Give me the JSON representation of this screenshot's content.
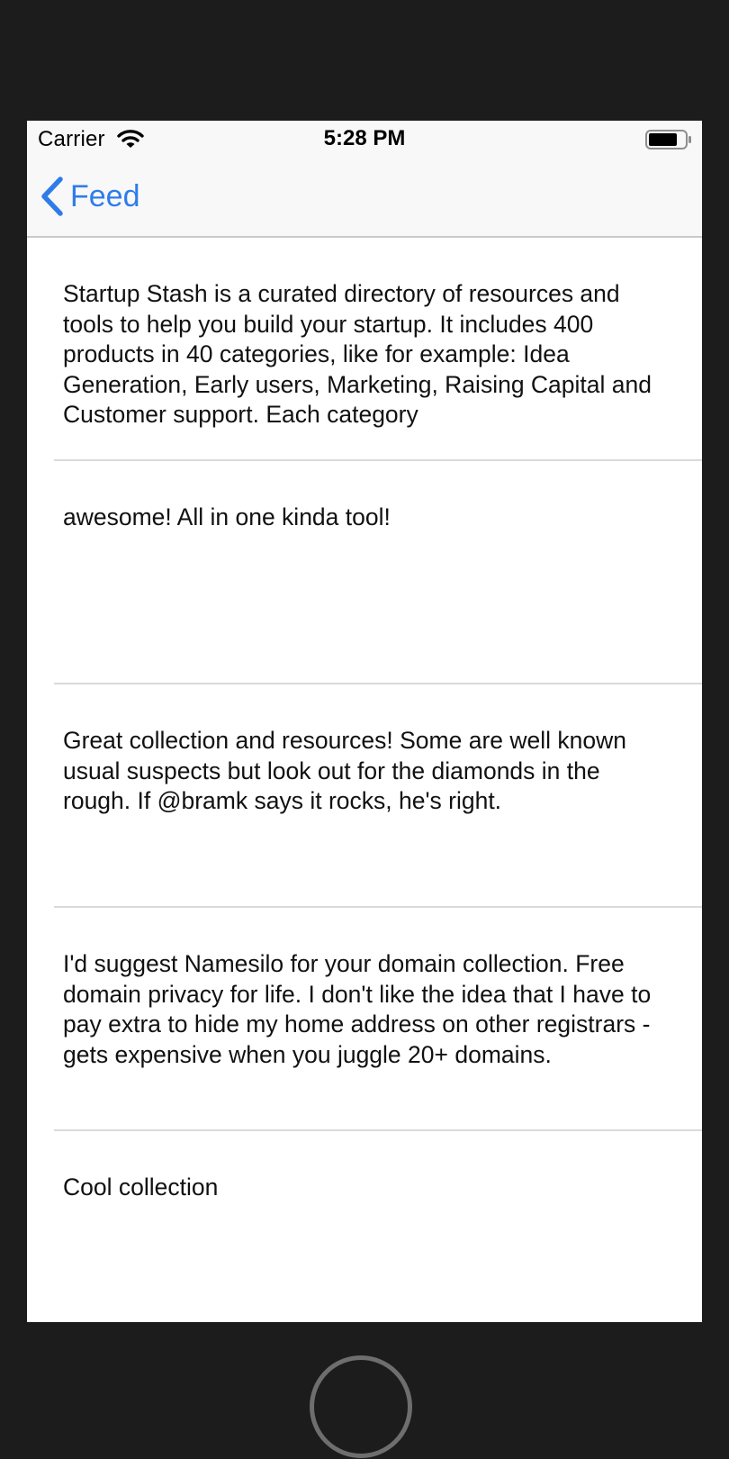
{
  "status_bar": {
    "carrier": "Carrier",
    "wifi_icon": "wifi-icon",
    "time": "5:28 PM",
    "battery_icon": "battery-icon"
  },
  "nav": {
    "back_icon": "chevron-left-icon",
    "back_label": "Feed"
  },
  "comments": [
    {
      "text": "Startup Stash is a curated directory of resources and tools to help you build your startup. It includes 400 products in 40 categories, like for example: Idea Generation, Early users, Marketing, Raising Capital and Customer support. Each category"
    },
    {
      "text": "awesome! All in one kinda tool!"
    },
    {
      "text": "Great collection and resources! Some are well known usual suspects but look out for the diamonds in the rough. If @bramk says it rocks, he's right."
    },
    {
      "text": "I'd suggest Namesilo for your domain collection. Free domain privacy for life. I don't like the idea that I have to pay extra to hide my home address on other registrars - gets expensive when you juggle 20+ domains."
    },
    {
      "text": "Cool collection"
    }
  ],
  "colors": {
    "tint": "#2f7ce9",
    "bezel": "#1c1c1c",
    "bar_background": "#f8f8f8",
    "separator": "#dadada"
  },
  "home_button_icon": "home-button-icon"
}
